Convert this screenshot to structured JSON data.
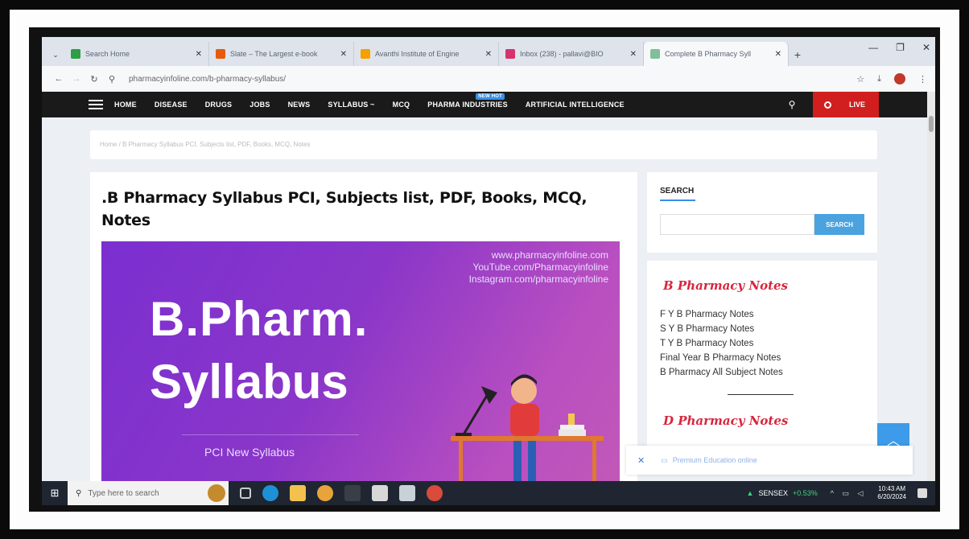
{
  "browser": {
    "tabs": [
      {
        "title": "Search Home",
        "color": "#2f9e44",
        "active": false
      },
      {
        "title": "Slate – The Largest e-book",
        "color": "#e8590c",
        "active": false
      },
      {
        "title": "Avanthi Institute of Engine",
        "color": "#f59f00",
        "active": false
      },
      {
        "title": "Inbox (238) - pallavi@BIO",
        "color": "#d6336c",
        "active": false
      },
      {
        "title": "Complete B Pharmacy Syll",
        "color": "#7fbf9a",
        "active": true
      }
    ],
    "url": "pharmacyinfoline.com/b-pharmacy-syllabus/"
  },
  "site_nav": {
    "items": [
      "HOME",
      "DISEASE",
      "DRUGS",
      "JOBS",
      "NEWS",
      "SYLLABUS ~",
      "MCQ",
      "PHARMA INDUSTRIES",
      "ARTIFICIAL INTELLIGENCE"
    ],
    "new_badge": "NEW HOT",
    "live_label": "LIVE"
  },
  "breadcrumb": "Home / B Pharmacy Syllabus PCI, Subjects list, PDF, Books, MCQ, Notes",
  "article": {
    "title": ".B Pharmacy Syllabus PCI, Subjects list, PDF, Books, MCQ, Notes",
    "banner": {
      "links": [
        "www.pharmacyinfoline.com",
        "YouTube.com/Pharmacyinfoline",
        "Instagram.com/pharmacyinfoline"
      ],
      "line1": "B.Pharm.",
      "line2": "Syllabus",
      "subtitle": "PCI New Syllabus"
    }
  },
  "sidebar": {
    "search_heading": "SEARCH",
    "search_button": "SEARCH",
    "b_notes_heading": "B Pharmacy Notes",
    "b_notes": [
      "F Y B Pharmacy Notes",
      "S Y B Pharmacy Notes",
      "T Y B Pharmacy Notes",
      "Final Year B Pharmacy Notes",
      "B Pharmacy All Subject Notes"
    ],
    "d_notes_heading": "D Pharmacy Notes"
  },
  "ad_bar": {
    "text": "Premium Education online"
  },
  "taskbar": {
    "search_placeholder": "Type here to search",
    "stock_name": "SENSEX",
    "stock_value": "+0.53%",
    "time": "10:43 AM",
    "date": "6/20/2024"
  },
  "colors": {
    "accent_blue": "#3d9be9",
    "live_red": "#d11f1f",
    "notes_red": "#d7263d",
    "banner_purple": "#7b2fd0"
  }
}
